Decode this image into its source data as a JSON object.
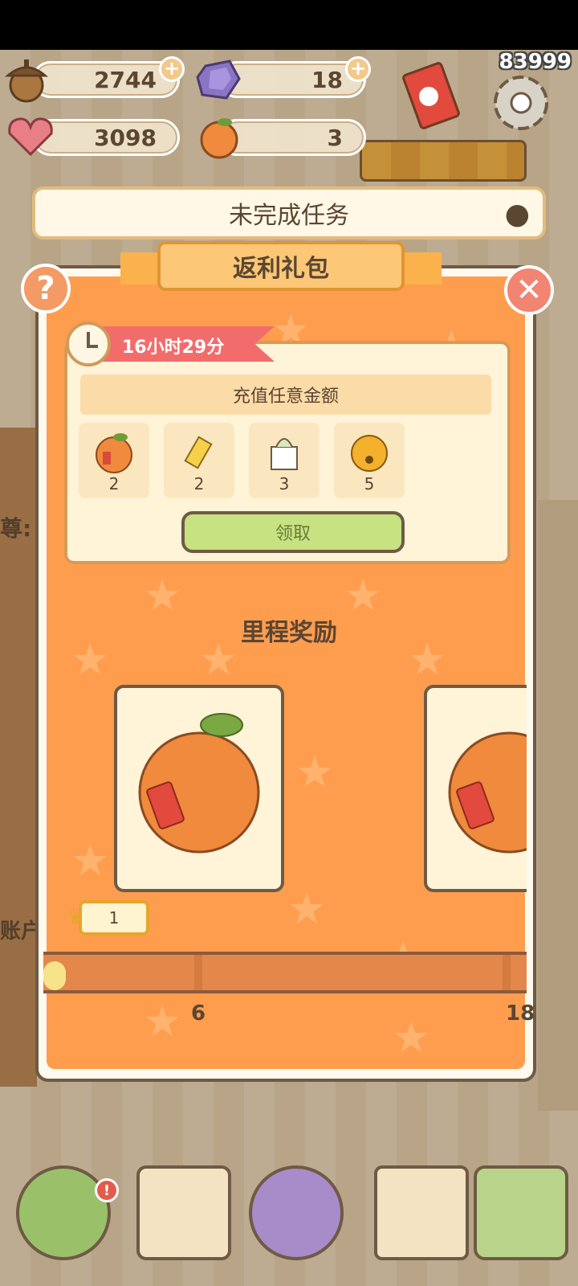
{
  "resources": {
    "acorn": "2744",
    "crystal": "18",
    "heart_gem": "3098",
    "orange": "3"
  },
  "top_counter": "83999",
  "task_bar": {
    "label": "未完成任务"
  },
  "panel": {
    "title": "返利礼包",
    "timer": "16小时29分",
    "requirement": "充值任意金额",
    "rewards": [
      {
        "name": "orange",
        "count": "2"
      },
      {
        "name": "ticket",
        "count": "2"
      },
      {
        "name": "gift-box",
        "count": "3"
      },
      {
        "name": "bell",
        "count": "5"
      }
    ],
    "claim_label": "领取",
    "milestone_title": "里程奖励",
    "milestone_badge": "1",
    "tick_labels": [
      "6",
      "18"
    ]
  },
  "side_text": {
    "left_1": "尊:",
    "left_2": "账户"
  },
  "colors": {
    "panel_orange": "#ff9d4f",
    "claim_green": "#c6e281",
    "timer_red": "#f26c6c"
  }
}
